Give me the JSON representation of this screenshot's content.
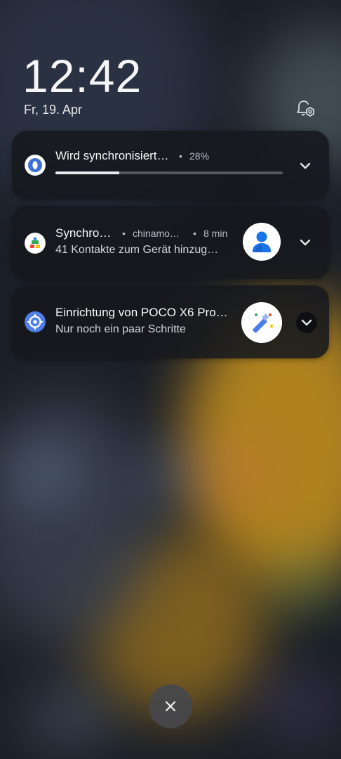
{
  "lockscreen": {
    "time": "12:42",
    "date": "Fr, 19. Apr"
  },
  "notifications": [
    {
      "title": "Wird synchronisiert…",
      "dot": "•",
      "meta": "28%",
      "progress": 0.28,
      "icon": "sync-app-icon"
    },
    {
      "title": "Synchro…",
      "dot": "•",
      "meta_account": "chinamo…",
      "dot2": "•",
      "meta_time": "8 min",
      "text": "41 Kontakte zum Gerät hinzug…",
      "icon": "google-contacts-sync-icon",
      "avatar": "person-avatar-icon"
    },
    {
      "title": "Einrichtung von POCO X6 Pro…",
      "text": "Nur noch ein paar Schritte",
      "icon": "settings-gear-icon",
      "avatar": "magic-wand-icon"
    }
  ],
  "colors": {
    "card_bg": "#16181e",
    "accent_blue": "#4f7fe6",
    "progress_fill": "#e9ebef"
  }
}
